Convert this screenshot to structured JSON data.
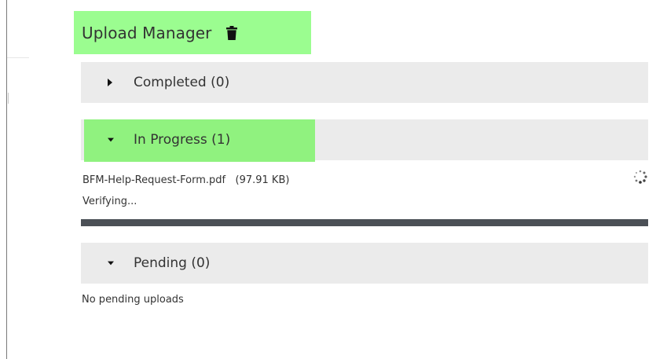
{
  "title": "Upload Manager",
  "sections": {
    "completed": {
      "label": "Completed (0)",
      "expanded": false
    },
    "in_progress": {
      "label": "In Progress (1)",
      "expanded": true,
      "file_name": "BFM-Help-Request-Form.pdf",
      "file_size": "(97.91 KB)",
      "status": "Verifying...",
      "progress_fraction": 1.0
    },
    "pending": {
      "label": "Pending (0)",
      "expanded": true,
      "empty_message": "No pending uploads"
    }
  },
  "icons": {
    "delete": "trash-icon",
    "collapsed": "caret-right-icon",
    "expanded": "caret-down-icon",
    "busy": "spinner-icon"
  },
  "colors": {
    "title_highlight": "#9bfd90",
    "section_highlight": "#90f27f",
    "section_bg": "#ebebeb",
    "progress_fill": "#4b5056"
  }
}
